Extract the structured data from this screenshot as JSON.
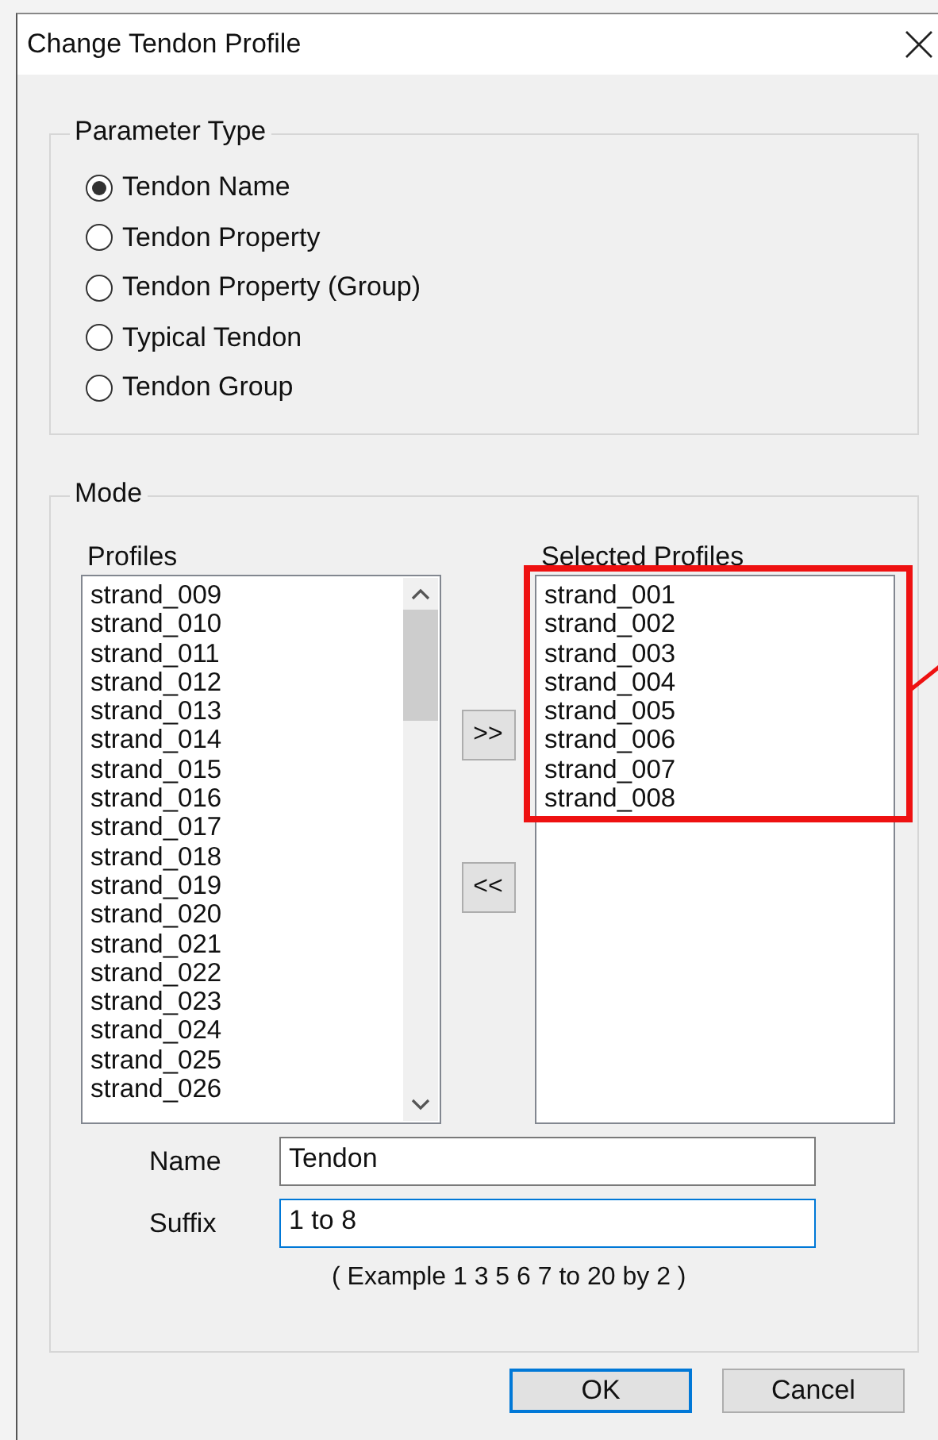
{
  "window": {
    "title": "Change Tendon Profile"
  },
  "parameter_type": {
    "title": "Parameter Type",
    "options": [
      {
        "label": "Tendon Name",
        "selected": true
      },
      {
        "label": "Tendon Property",
        "selected": false
      },
      {
        "label": "Tendon Property (Group)",
        "selected": false
      },
      {
        "label": "Typical Tendon",
        "selected": false
      },
      {
        "label": "Tendon Group",
        "selected": false
      }
    ]
  },
  "mode": {
    "title": "Mode",
    "profiles": {
      "label": "Profiles",
      "items": [
        "strand_009",
        "strand_010",
        "strand_011",
        "strand_012",
        "strand_013",
        "strand_014",
        "strand_015",
        "strand_016",
        "strand_017",
        "strand_018",
        "strand_019",
        "strand_020",
        "strand_021",
        "strand_022",
        "strand_023",
        "strand_024",
        "strand_025",
        "strand_026"
      ]
    },
    "move_buttons": [
      ">>",
      "<<"
    ],
    "selected_profiles": {
      "label": "Selected Profiles",
      "highlighted": true,
      "items": [
        "strand_001",
        "strand_002",
        "strand_003",
        "strand_004",
        "strand_005",
        "strand_006",
        "strand_007",
        "strand_008"
      ]
    },
    "name": {
      "label": "Name",
      "value": "Tendon",
      "focused": false
    },
    "suffix": {
      "label": "Suffix",
      "value": "1 to 8",
      "focused": true
    },
    "example": "( Example 1 3 5 6 7 to 20 by 2 )"
  },
  "buttons": [
    {
      "label": "OK",
      "default": true
    },
    {
      "label": "Cancel",
      "default": false
    }
  ]
}
